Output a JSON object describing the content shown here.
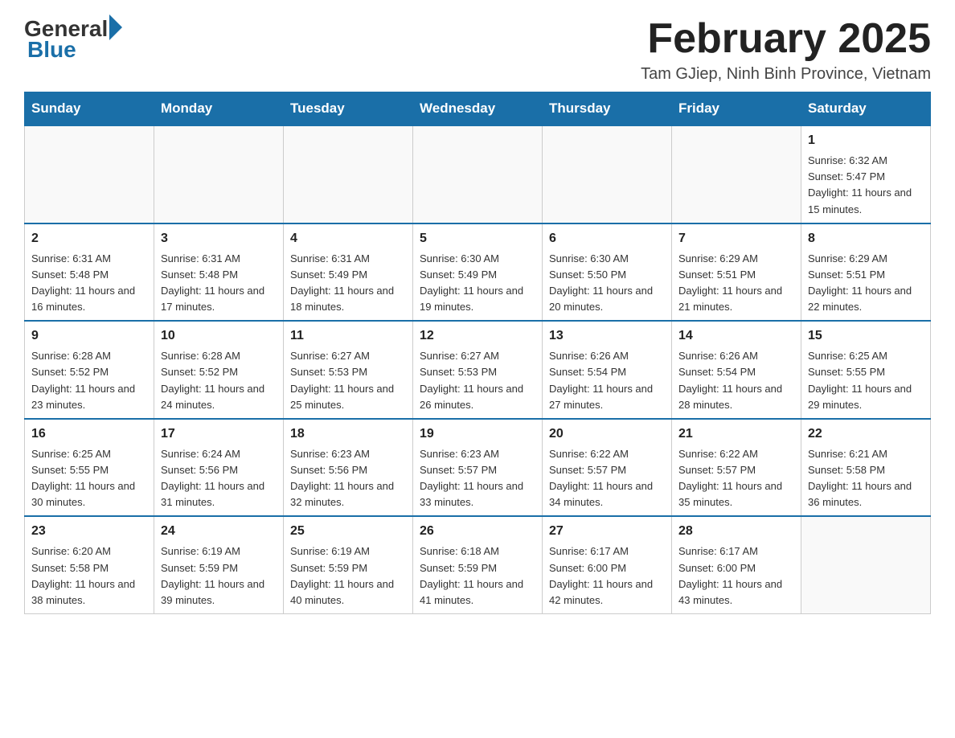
{
  "header": {
    "logo_general": "General",
    "logo_blue": "Blue",
    "month_title": "February 2025",
    "location": "Tam GJiep, Ninh Binh Province, Vietnam"
  },
  "days_of_week": [
    "Sunday",
    "Monday",
    "Tuesday",
    "Wednesday",
    "Thursday",
    "Friday",
    "Saturday"
  ],
  "weeks": [
    [
      {
        "day": "",
        "sunrise": "",
        "sunset": "",
        "daylight": ""
      },
      {
        "day": "",
        "sunrise": "",
        "sunset": "",
        "daylight": ""
      },
      {
        "day": "",
        "sunrise": "",
        "sunset": "",
        "daylight": ""
      },
      {
        "day": "",
        "sunrise": "",
        "sunset": "",
        "daylight": ""
      },
      {
        "day": "",
        "sunrise": "",
        "sunset": "",
        "daylight": ""
      },
      {
        "day": "",
        "sunrise": "",
        "sunset": "",
        "daylight": ""
      },
      {
        "day": "1",
        "sunrise": "Sunrise: 6:32 AM",
        "sunset": "Sunset: 5:47 PM",
        "daylight": "Daylight: 11 hours and 15 minutes."
      }
    ],
    [
      {
        "day": "2",
        "sunrise": "Sunrise: 6:31 AM",
        "sunset": "Sunset: 5:48 PM",
        "daylight": "Daylight: 11 hours and 16 minutes."
      },
      {
        "day": "3",
        "sunrise": "Sunrise: 6:31 AM",
        "sunset": "Sunset: 5:48 PM",
        "daylight": "Daylight: 11 hours and 17 minutes."
      },
      {
        "day": "4",
        "sunrise": "Sunrise: 6:31 AM",
        "sunset": "Sunset: 5:49 PM",
        "daylight": "Daylight: 11 hours and 18 minutes."
      },
      {
        "day": "5",
        "sunrise": "Sunrise: 6:30 AM",
        "sunset": "Sunset: 5:49 PM",
        "daylight": "Daylight: 11 hours and 19 minutes."
      },
      {
        "day": "6",
        "sunrise": "Sunrise: 6:30 AM",
        "sunset": "Sunset: 5:50 PM",
        "daylight": "Daylight: 11 hours and 20 minutes."
      },
      {
        "day": "7",
        "sunrise": "Sunrise: 6:29 AM",
        "sunset": "Sunset: 5:51 PM",
        "daylight": "Daylight: 11 hours and 21 minutes."
      },
      {
        "day": "8",
        "sunrise": "Sunrise: 6:29 AM",
        "sunset": "Sunset: 5:51 PM",
        "daylight": "Daylight: 11 hours and 22 minutes."
      }
    ],
    [
      {
        "day": "9",
        "sunrise": "Sunrise: 6:28 AM",
        "sunset": "Sunset: 5:52 PM",
        "daylight": "Daylight: 11 hours and 23 minutes."
      },
      {
        "day": "10",
        "sunrise": "Sunrise: 6:28 AM",
        "sunset": "Sunset: 5:52 PM",
        "daylight": "Daylight: 11 hours and 24 minutes."
      },
      {
        "day": "11",
        "sunrise": "Sunrise: 6:27 AM",
        "sunset": "Sunset: 5:53 PM",
        "daylight": "Daylight: 11 hours and 25 minutes."
      },
      {
        "day": "12",
        "sunrise": "Sunrise: 6:27 AM",
        "sunset": "Sunset: 5:53 PM",
        "daylight": "Daylight: 11 hours and 26 minutes."
      },
      {
        "day": "13",
        "sunrise": "Sunrise: 6:26 AM",
        "sunset": "Sunset: 5:54 PM",
        "daylight": "Daylight: 11 hours and 27 minutes."
      },
      {
        "day": "14",
        "sunrise": "Sunrise: 6:26 AM",
        "sunset": "Sunset: 5:54 PM",
        "daylight": "Daylight: 11 hours and 28 minutes."
      },
      {
        "day": "15",
        "sunrise": "Sunrise: 6:25 AM",
        "sunset": "Sunset: 5:55 PM",
        "daylight": "Daylight: 11 hours and 29 minutes."
      }
    ],
    [
      {
        "day": "16",
        "sunrise": "Sunrise: 6:25 AM",
        "sunset": "Sunset: 5:55 PM",
        "daylight": "Daylight: 11 hours and 30 minutes."
      },
      {
        "day": "17",
        "sunrise": "Sunrise: 6:24 AM",
        "sunset": "Sunset: 5:56 PM",
        "daylight": "Daylight: 11 hours and 31 minutes."
      },
      {
        "day": "18",
        "sunrise": "Sunrise: 6:23 AM",
        "sunset": "Sunset: 5:56 PM",
        "daylight": "Daylight: 11 hours and 32 minutes."
      },
      {
        "day": "19",
        "sunrise": "Sunrise: 6:23 AM",
        "sunset": "Sunset: 5:57 PM",
        "daylight": "Daylight: 11 hours and 33 minutes."
      },
      {
        "day": "20",
        "sunrise": "Sunrise: 6:22 AM",
        "sunset": "Sunset: 5:57 PM",
        "daylight": "Daylight: 11 hours and 34 minutes."
      },
      {
        "day": "21",
        "sunrise": "Sunrise: 6:22 AM",
        "sunset": "Sunset: 5:57 PM",
        "daylight": "Daylight: 11 hours and 35 minutes."
      },
      {
        "day": "22",
        "sunrise": "Sunrise: 6:21 AM",
        "sunset": "Sunset: 5:58 PM",
        "daylight": "Daylight: 11 hours and 36 minutes."
      }
    ],
    [
      {
        "day": "23",
        "sunrise": "Sunrise: 6:20 AM",
        "sunset": "Sunset: 5:58 PM",
        "daylight": "Daylight: 11 hours and 38 minutes."
      },
      {
        "day": "24",
        "sunrise": "Sunrise: 6:19 AM",
        "sunset": "Sunset: 5:59 PM",
        "daylight": "Daylight: 11 hours and 39 minutes."
      },
      {
        "day": "25",
        "sunrise": "Sunrise: 6:19 AM",
        "sunset": "Sunset: 5:59 PM",
        "daylight": "Daylight: 11 hours and 40 minutes."
      },
      {
        "day": "26",
        "sunrise": "Sunrise: 6:18 AM",
        "sunset": "Sunset: 5:59 PM",
        "daylight": "Daylight: 11 hours and 41 minutes."
      },
      {
        "day": "27",
        "sunrise": "Sunrise: 6:17 AM",
        "sunset": "Sunset: 6:00 PM",
        "daylight": "Daylight: 11 hours and 42 minutes."
      },
      {
        "day": "28",
        "sunrise": "Sunrise: 6:17 AM",
        "sunset": "Sunset: 6:00 PM",
        "daylight": "Daylight: 11 hours and 43 minutes."
      },
      {
        "day": "",
        "sunrise": "",
        "sunset": "",
        "daylight": ""
      }
    ]
  ]
}
